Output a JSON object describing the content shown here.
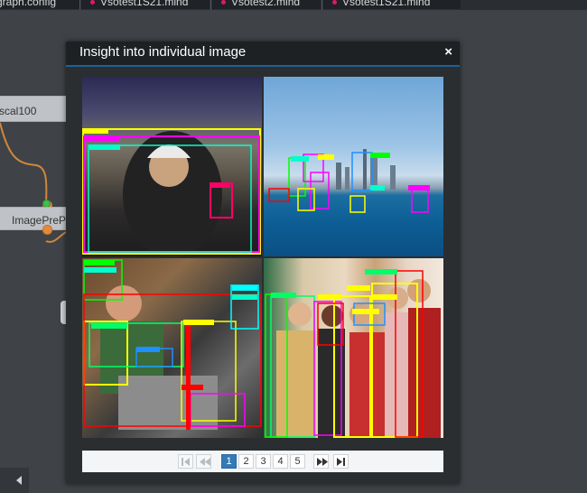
{
  "tabs": [
    {
      "label": "graph.config",
      "has_dot": false
    },
    {
      "label": "Vsotest1S21.mind",
      "has_dot": true
    },
    {
      "label": "Vsotest2.mind",
      "has_dot": true
    },
    {
      "label": "Vsotest1S21.mind",
      "has_dot": true
    }
  ],
  "canvas": {
    "node_scal_label": "scal100",
    "node_pre_label": "ImagePrePr"
  },
  "modal": {
    "title": "Insight into individual image",
    "close_glyph": "×"
  },
  "pager": {
    "pages": [
      "1",
      "2",
      "3",
      "4",
      "5"
    ],
    "active_page": "1"
  },
  "colors": {
    "modal_bg": "#1d2124",
    "accent_line": "#1e5f9a",
    "active_page_bg": "#337ab7",
    "detection_box_colors": [
      "#ffff00",
      "#00ffff",
      "#ff00ff",
      "#00ff00",
      "#ff0000",
      "#ff8c00",
      "#1e90ff"
    ]
  },
  "images": [
    {
      "id_name": "image-motorbike-rider"
    },
    {
      "id_name": "image-city-harbor"
    },
    {
      "id_name": "image-man-laptop"
    },
    {
      "id_name": "image-group-people"
    }
  ]
}
